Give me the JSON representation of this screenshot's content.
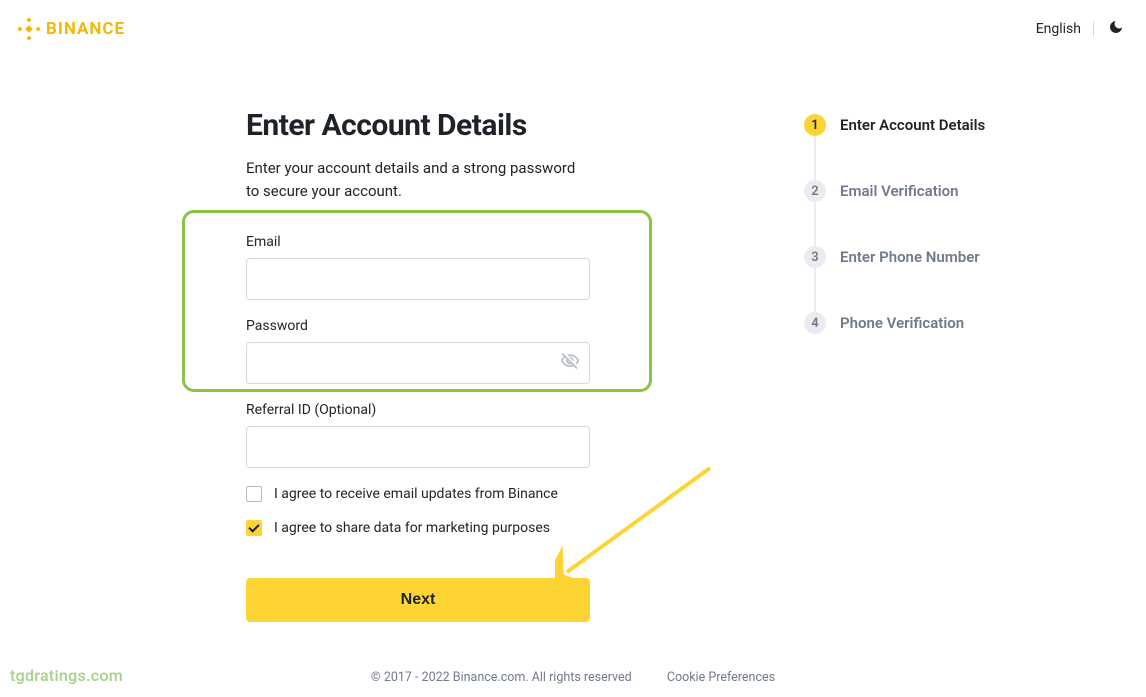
{
  "header": {
    "brand": "BINANCE",
    "language": "English"
  },
  "form": {
    "title": "Enter Account Details",
    "subtitle": "Enter your account details and a strong password to secure your account.",
    "email_label": "Email",
    "email_value": "",
    "password_label": "Password",
    "password_value": "",
    "referral_label": "Referral ID (Optional)",
    "referral_value": "",
    "agree_email_label": "I agree to receive email updates from Binance",
    "agree_email_checked": false,
    "agree_marketing_label": "I agree to share data for marketing purposes",
    "agree_marketing_checked": true,
    "next_label": "Next"
  },
  "steps": [
    {
      "num": "1",
      "label": "Enter Account Details",
      "active": true
    },
    {
      "num": "2",
      "label": "Email Verification",
      "active": false
    },
    {
      "num": "3",
      "label": "Enter Phone Number",
      "active": false
    },
    {
      "num": "4",
      "label": "Phone Verification",
      "active": false
    }
  ],
  "footer": {
    "copyright": "© 2017 - 2022 Binance.com. All rights reserved",
    "cookie": "Cookie Preferences"
  },
  "watermark": "tgdratings.com",
  "colors": {
    "accent": "#fcd535",
    "brand": "#f0b90b",
    "highlight": "#8bc34a"
  }
}
